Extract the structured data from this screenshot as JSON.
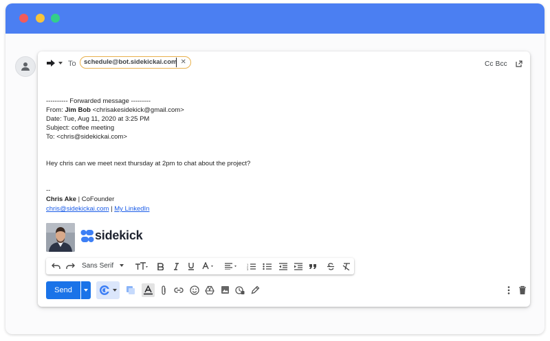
{
  "window": {
    "dots": [
      {
        "name": "close",
        "color": "#f25b5b"
      },
      {
        "name": "minimize",
        "color": "#f7c43b"
      },
      {
        "name": "maximize",
        "color": "#33cf8a"
      }
    ],
    "titlebar_color": "#4b7ff2"
  },
  "compose": {
    "to_label": "To",
    "recipient": "schedule@bot.sidekickai.com",
    "recipient_remove": "✕",
    "cc_bcc": "Cc Bcc"
  },
  "message": {
    "fwd_header": "---------- Forwarded message ---------",
    "from_label": "From: ",
    "from_name": "Jim Bob",
    "from_email": " <chrisakesidekick@gmail.com>",
    "date": "Date: Tue, Aug 11, 2020 at 3:25 PM",
    "subject": "Subject: coffee meeting",
    "to": "To: <chris@sidekickai.com>",
    "body": "Hey chris can we meet next thursday at 2pm to chat about the project?",
    "sig_dash": "--",
    "sig_name": "Chris Ake",
    "sig_title": " | CoFounder",
    "sig_email": "chris@sidekickai.com",
    "sig_sep": " | ",
    "sig_linkedin": "My LinkedIn",
    "brand": "sidekick"
  },
  "format_toolbar": {
    "font": "Sans Serif"
  },
  "actions": {
    "send_label": "Send",
    "accent": "#1a73e8"
  },
  "icons": [
    "forward-icon",
    "person-icon",
    "popout-icon",
    "undo-icon",
    "redo-icon",
    "text-size-icon",
    "bold-icon",
    "italic-icon",
    "underline-icon",
    "text-color-icon",
    "align-icon",
    "numbered-list-icon",
    "bulleted-list-icon",
    "indent-less-icon",
    "indent-more-icon",
    "quote-icon",
    "strikethrough-icon",
    "remove-formatting-icon",
    "sidekick-logo-icon",
    "layers-icon",
    "formatting-icon",
    "attach-icon",
    "link-icon",
    "emoji-icon",
    "drive-icon",
    "photo-icon",
    "confidential-icon",
    "signature-icon",
    "more-options-icon",
    "trash-icon"
  ]
}
